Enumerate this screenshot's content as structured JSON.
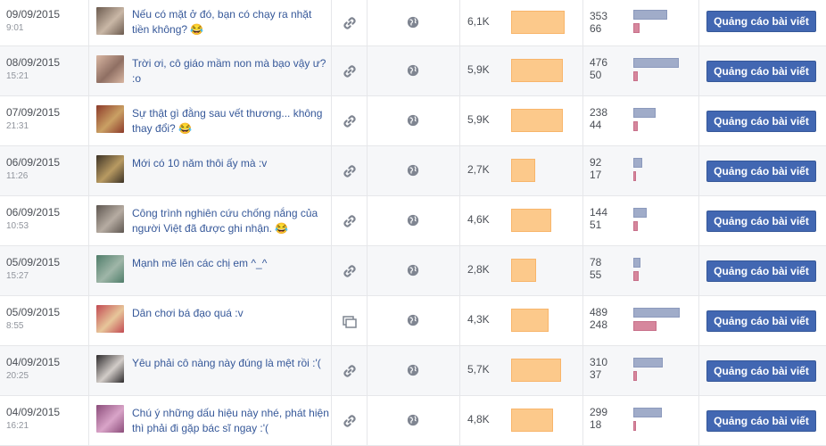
{
  "colors": {
    "link": "#365899",
    "reach_bar": "#fcc98b",
    "engagement_bar_primary": "#a0acc9",
    "engagement_bar_secondary": "#d6879d",
    "button": "#4267b2"
  },
  "boost_label": "Quảng cáo bài viết",
  "posts": [
    {
      "date": "09/09/2015",
      "time": "9:01",
      "message": "Nếu có mặt ở đó, bạn có chạy ra nhặt tiền không? 😂",
      "type_icon": "link-icon",
      "targeting_icon": "globe-icon",
      "reach": "6,1K",
      "reach_k": 6.1,
      "engagement_1": "353",
      "engagement_2": "66",
      "thumb_colors": [
        "#6b5a4e",
        "#c9b7a6"
      ]
    },
    {
      "date": "08/09/2015",
      "time": "15:21",
      "message": "Trời ơi, cô giáo mầm non mà bạo vậy ư? :o",
      "type_icon": "link-icon",
      "targeting_icon": "globe-icon",
      "reach": "5,9K",
      "reach_k": 5.9,
      "engagement_1": "476",
      "engagement_2": "50",
      "thumb_colors": [
        "#d9b7a3",
        "#8f6f63"
      ]
    },
    {
      "date": "07/09/2015",
      "time": "21:31",
      "message": "Sự thật gì đằng sau vết thương... không thay đổi? 😂",
      "type_icon": "link-icon",
      "targeting_icon": "globe-icon",
      "reach": "5,9K",
      "reach_k": 5.9,
      "engagement_1": "238",
      "engagement_2": "44",
      "thumb_colors": [
        "#8c3a2a",
        "#caa064"
      ]
    },
    {
      "date": "06/09/2015",
      "time": "11:26",
      "message": "Mới có 10 năm thôi ấy mà :v",
      "type_icon": "link-icon",
      "targeting_icon": "globe-icon",
      "reach": "2,7K",
      "reach_k": 2.7,
      "engagement_1": "92",
      "engagement_2": "17",
      "thumb_colors": [
        "#3c3226",
        "#b89a62"
      ]
    },
    {
      "date": "06/09/2015",
      "time": "10:53",
      "message": "Công trình nghiên cứu chống nắng của người Việt đã được ghi nhận. 😂",
      "type_icon": "link-icon",
      "targeting_icon": "globe-icon",
      "reach": "4,6K",
      "reach_k": 4.6,
      "engagement_1": "144",
      "engagement_2": "51",
      "thumb_colors": [
        "#5e5650",
        "#b6aca2"
      ]
    },
    {
      "date": "05/09/2015",
      "time": "15:27",
      "message": "Mạnh mẽ lên các chị em ^_^",
      "type_icon": "link-icon",
      "targeting_icon": "globe-icon",
      "reach": "2,8K",
      "reach_k": 2.8,
      "engagement_1": "78",
      "engagement_2": "55",
      "thumb_colors": [
        "#4f7d6a",
        "#9fb6a8"
      ]
    },
    {
      "date": "05/09/2015",
      "time": "8:55",
      "message": "Dân chơi bá đạo quá :v",
      "type_icon": "album-icon",
      "targeting_icon": "globe-icon",
      "reach": "4,3K",
      "reach_k": 4.3,
      "engagement_1": "489",
      "engagement_2": "248",
      "thumb_colors": [
        "#c24a52",
        "#e7c69a"
      ]
    },
    {
      "date": "04/09/2015",
      "time": "20:25",
      "message": "Yêu phải cô nàng này đúng là mệt rồi :'(",
      "type_icon": "link-icon",
      "targeting_icon": "globe-icon",
      "reach": "5,7K",
      "reach_k": 5.7,
      "engagement_1": "310",
      "engagement_2": "37",
      "thumb_colors": [
        "#2d2a2c",
        "#d2ccc8"
      ]
    },
    {
      "date": "04/09/2015",
      "time": "16:21",
      "message": "Chú ý những dấu hiệu này nhé, phát hiện thì phải đi gặp bác sĩ ngay :'(",
      "type_icon": "link-icon",
      "targeting_icon": "globe-icon",
      "reach": "4,8K",
      "reach_k": 4.8,
      "engagement_1": "299",
      "engagement_2": "18",
      "thumb_colors": [
        "#8b4c7a",
        "#d9a4c8"
      ]
    }
  ]
}
